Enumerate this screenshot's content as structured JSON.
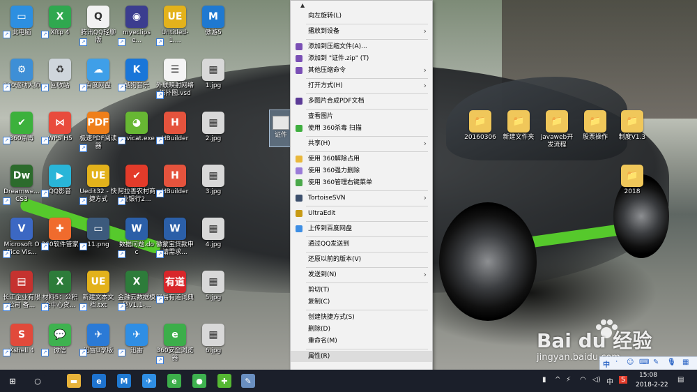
{
  "desktop_icons": [
    {
      "label": "此电脑",
      "glyph": "▭",
      "color": "#2d8fe0"
    },
    {
      "label": "Xftp 4",
      "glyph": "X",
      "color": "#2fa84f"
    },
    {
      "label": "腾讯QQ轻聊版",
      "glyph": "Q",
      "color": "#f2f2f2"
    },
    {
      "label": "myeclipse...",
      "glyph": "◉",
      "color": "#3b3d8f"
    },
    {
      "label": "Untitled-1....",
      "glyph": "UE",
      "color": "#e3b21b"
    },
    {
      "label": "傲游5",
      "glyph": "M",
      "color": "#1f79d1"
    },
    {
      "label": "360驱动大师",
      "glyph": "⚙",
      "color": "#3e8fd6"
    },
    {
      "label": "回收站",
      "glyph": "♻",
      "color": "#cfd6dc"
    },
    {
      "label": "百度网盘",
      "glyph": "☁",
      "color": "#3f9fe8"
    },
    {
      "label": "酷狗音乐",
      "glyph": "K",
      "color": "#1976d9"
    },
    {
      "label": "外联映射网络拓扑图.vsd",
      "glyph": "☰",
      "color": "#f4f4f4"
    },
    {
      "label": "1.jpg",
      "glyph": "▦",
      "color": "#d8d8d8"
    },
    {
      "label": "360杀毒",
      "glyph": "✔",
      "color": "#3cb13c"
    },
    {
      "label": "WPS H5",
      "glyph": "⋈",
      "color": "#e94b3c"
    },
    {
      "label": "极速PDF阅读器",
      "glyph": "PDF",
      "color": "#ef7f1a"
    },
    {
      "label": "navicat.exe",
      "glyph": "◕",
      "color": "#67b733"
    },
    {
      "label": "HBuilder",
      "glyph": "H",
      "color": "#e5533d"
    },
    {
      "label": "2.jpg",
      "glyph": "▦",
      "color": "#d8d8d8"
    },
    {
      "label": "Dreamwe... CS3",
      "glyph": "Dw",
      "color": "#2c6b2c"
    },
    {
      "label": "QQ影音",
      "glyph": "▶",
      "color": "#29b5d8"
    },
    {
      "label": "Uedit32 - 快捷方式",
      "glyph": "UE",
      "color": "#e3b21b"
    },
    {
      "label": "阿拉善农村商业银行2...",
      "glyph": "✔",
      "color": "#e33b2a"
    },
    {
      "label": "HBuilder",
      "glyph": "H",
      "color": "#e5533d"
    },
    {
      "label": "3.jpg",
      "glyph": "▦",
      "color": "#d8d8d8"
    },
    {
      "label": "Microsoft Office Vis...",
      "glyph": "V",
      "color": "#3c68c3"
    },
    {
      "label": "360软件管家",
      "glyph": "✚",
      "color": "#f06b2d"
    },
    {
      "label": "11.png",
      "glyph": "▭",
      "color": "#3c5a7c"
    },
    {
      "label": "数据问题.doc",
      "glyph": "W",
      "color": "#2b5fa8"
    },
    {
      "label": "徽蒙宝贷款申请需求...",
      "glyph": "W",
      "color": "#2b5fa8"
    },
    {
      "label": "4.jpg",
      "glyph": "▦",
      "color": "#d8d8d8"
    },
    {
      "label": "长江企业有限公司 备...",
      "glyph": "▤",
      "color": "#c5322f"
    },
    {
      "label": "材料5：公积金中心贷...",
      "glyph": "X",
      "color": "#2d7c3a"
    },
    {
      "label": "新建文本文档.txt",
      "glyph": "UE",
      "color": "#e3b21b"
    },
    {
      "label": "金融云数据模型V1.1-...",
      "glyph": "X",
      "color": "#2d7c3a"
    },
    {
      "label": "网易有道词典",
      "glyph": "有道",
      "color": "#d8262a"
    },
    {
      "label": "5.jpg",
      "glyph": "▦",
      "color": "#d8d8d8"
    },
    {
      "label": "Xshell 4",
      "glyph": "S",
      "color": "#e14a3b"
    },
    {
      "label": "微信",
      "glyph": "💬",
      "color": "#3eb24f"
    },
    {
      "label": "迅雷U享版",
      "glyph": "✈",
      "color": "#2b7ad6"
    },
    {
      "label": "迅雷",
      "glyph": "✈",
      "color": "#2f8ee4"
    },
    {
      "label": "360安全浏览器",
      "glyph": "e",
      "color": "#3cae4a"
    },
    {
      "label": "6.jpg",
      "glyph": "▦",
      "color": "#d8d8d8"
    }
  ],
  "right_icons": [
    {
      "label": "20160306",
      "glyph": "📁"
    },
    {
      "label": "新建文件夹",
      "glyph": "📁"
    },
    {
      "label": "javaweb开发流程",
      "glyph": "📁"
    },
    {
      "label": "股票操作",
      "glyph": "📁"
    },
    {
      "label": "制度V1.3",
      "glyph": "📁"
    },
    {
      "label": "2018",
      "glyph": "📁"
    }
  ],
  "selected_file": {
    "label": "证件"
  },
  "context_menu": {
    "items": [
      {
        "label": "向左旋转(L)",
        "icon": "",
        "sub": false
      },
      {
        "sep": true
      },
      {
        "label": "播放到设备",
        "icon": "",
        "sub": true
      },
      {
        "sep": true
      },
      {
        "label": "添加到压缩文件(A)...",
        "icon": "winrar-icon",
        "sub": false
      },
      {
        "label": "添加到 \"证件.zip\" (T)",
        "icon": "winrar-icon",
        "sub": false
      },
      {
        "label": "其他压缩命令",
        "icon": "winrar-icon",
        "sub": true
      },
      {
        "sep": true
      },
      {
        "label": "打开方式(H)",
        "icon": "",
        "sub": true
      },
      {
        "sep": true
      },
      {
        "label": "多图片合成PDF文档",
        "icon": "pdf-icon",
        "sub": false
      },
      {
        "sep": true
      },
      {
        "label": "查看图片",
        "icon": "",
        "sub": false
      },
      {
        "label": "使用 360杀毒 扫描",
        "icon": "shield-icon",
        "sub": false
      },
      {
        "sep": true
      },
      {
        "label": "共享(H)",
        "icon": "",
        "sub": true
      },
      {
        "sep": true
      },
      {
        "label": "使用 360解除占用",
        "icon": "folder-icon",
        "sub": false
      },
      {
        "label": "使用 360强力删除",
        "icon": "bin-icon",
        "sub": false
      },
      {
        "label": "使用 360管理右键菜单",
        "icon": "360-icon",
        "sub": false
      },
      {
        "sep": true
      },
      {
        "label": "TortoiseSVN",
        "icon": "svn-icon",
        "sub": true
      },
      {
        "sep": true
      },
      {
        "label": "UltraEdit",
        "icon": "ue-icon",
        "sub": false
      },
      {
        "sep": true
      },
      {
        "label": "上传到百度网盘",
        "icon": "cloud-icon",
        "sub": false
      },
      {
        "sep": true
      },
      {
        "label": "通过QQ发送到",
        "icon": "",
        "sub": false
      },
      {
        "sep": true
      },
      {
        "label": "还原以前的版本(V)",
        "icon": "",
        "sub": false
      },
      {
        "sep": true
      },
      {
        "label": "发送到(N)",
        "icon": "",
        "sub": true
      },
      {
        "sep": true
      },
      {
        "label": "剪切(T)",
        "icon": "",
        "sub": false
      },
      {
        "label": "复制(C)",
        "icon": "",
        "sub": false
      },
      {
        "sep": true
      },
      {
        "label": "创建快捷方式(S)",
        "icon": "",
        "sub": false
      },
      {
        "label": "删除(D)",
        "icon": "",
        "sub": false
      },
      {
        "label": "重命名(M)",
        "icon": "",
        "sub": false
      },
      {
        "sep": true
      },
      {
        "label": "属性(R)",
        "icon": "",
        "sub": false,
        "highlighted": true
      }
    ],
    "icon_colors": {
      "winrar-icon": "#7a4fb5",
      "pdf-icon": "#5b3a96",
      "shield-icon": "#3fae3f",
      "folder-icon": "#e9b73a",
      "bin-icon": "#9a7bd8",
      "360-icon": "#4aa84a",
      "svn-icon": "#3c4f6c",
      "ue-icon": "#c79a15",
      "cloud-icon": "#3d8ee4"
    }
  },
  "taskbar": {
    "apps": [
      {
        "name": "start-icon",
        "glyph": "⊞",
        "color": "#1b1f2a"
      },
      {
        "name": "cortana-icon",
        "glyph": "○",
        "color": "#1b1f2a"
      },
      {
        "name": "explorer-icon",
        "glyph": "▬",
        "color": "#e8b33a"
      },
      {
        "name": "ie-icon",
        "glyph": "e",
        "color": "#1e73cf"
      },
      {
        "name": "maxthon-icon",
        "glyph": "M",
        "color": "#1f79d1"
      },
      {
        "name": "xunlei-icon",
        "glyph": "✈",
        "color": "#2f8ee4"
      },
      {
        "name": "360browser-icon",
        "glyph": "e",
        "color": "#3cae4a"
      },
      {
        "name": "wechat-icon",
        "glyph": "●",
        "color": "#3eb24f"
      },
      {
        "name": "360-icon",
        "glyph": "✚",
        "color": "#55b833"
      },
      {
        "name": "paint-icon",
        "glyph": "✎",
        "color": "#6a8fc0"
      }
    ],
    "time": "15:08",
    "date": "2018-2-22",
    "ime": "中"
  },
  "watermark": {
    "brand": "Bai du 经验",
    "url": "jingyan.baidu.com"
  }
}
